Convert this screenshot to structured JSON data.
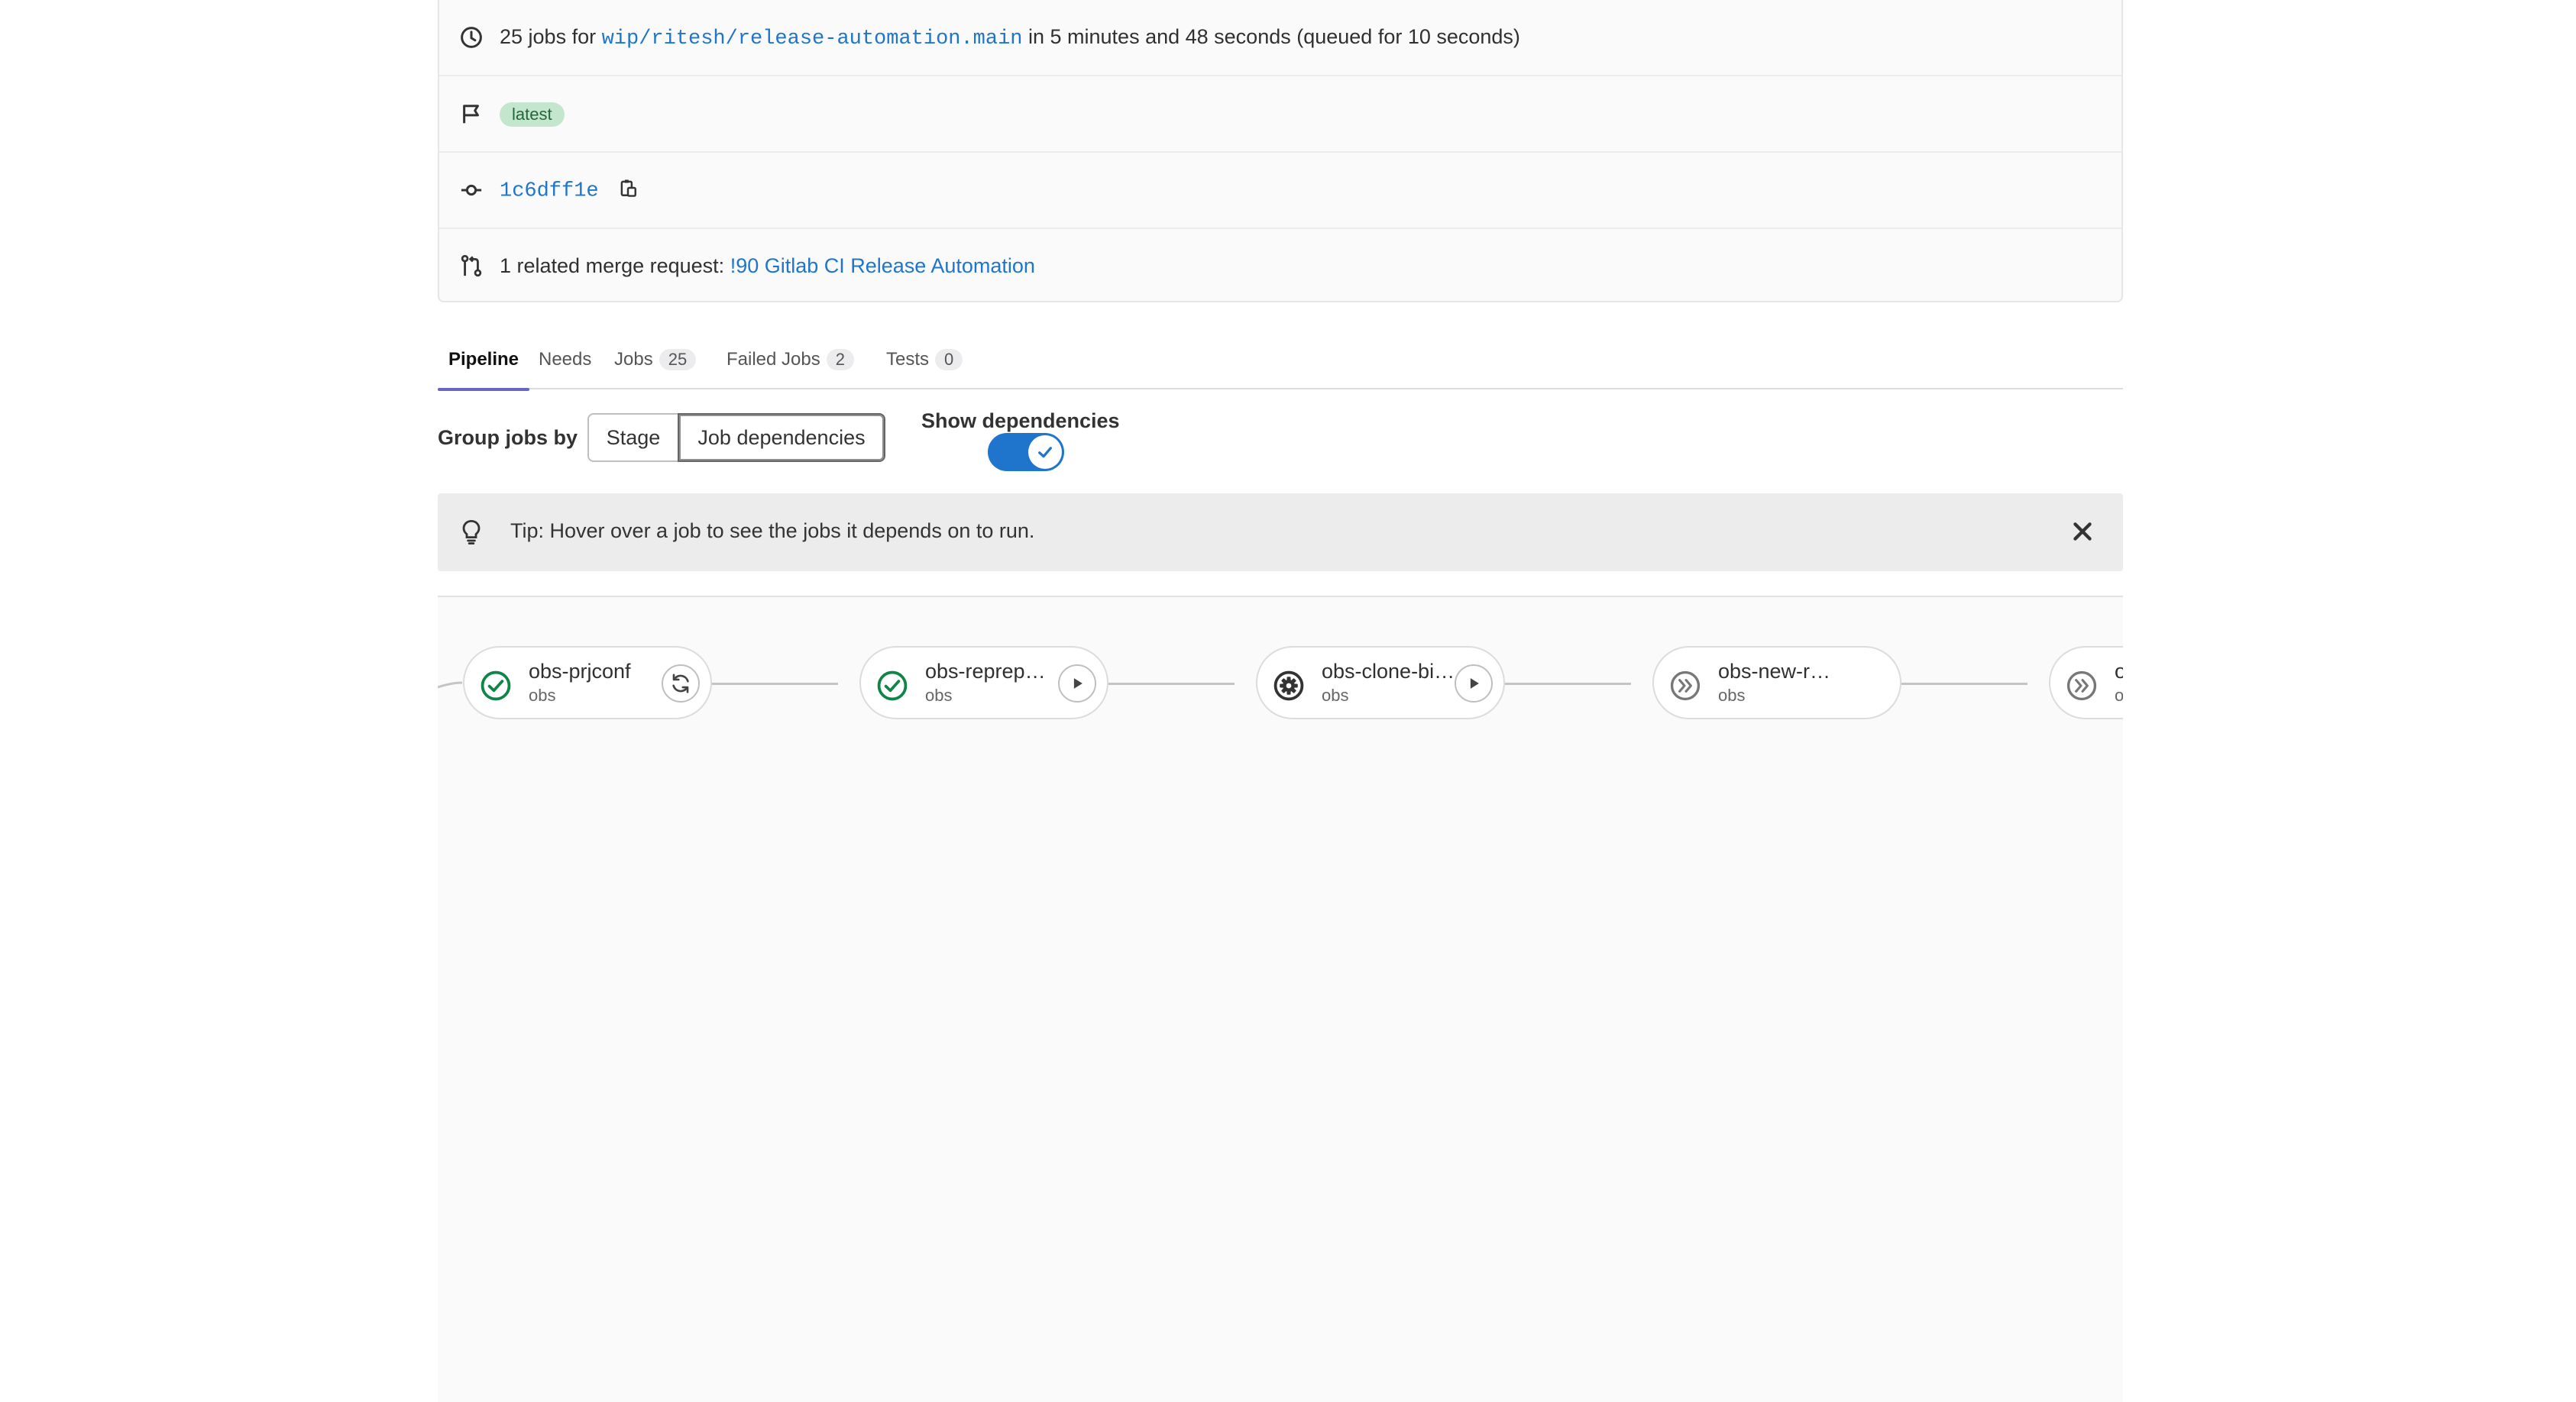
{
  "pipeline_info": {
    "jobs_summary_prefix": "25 jobs for",
    "ref": "wip/ritesh/release-automation.main",
    "jobs_summary_suffix": "in 5 minutes and 48 seconds (queued for 10 seconds)",
    "badge": "latest",
    "commit_sha": "1c6dff1e",
    "merge_request_prefix": "1 related merge request:",
    "merge_request_link": "!90 Gitlab CI Release Automation"
  },
  "tabs": [
    {
      "label": "Pipeline",
      "count": null
    },
    {
      "label": "Needs",
      "count": null
    },
    {
      "label": "Jobs",
      "count": "25"
    },
    {
      "label": "Failed Jobs",
      "count": "2"
    },
    {
      "label": "Tests",
      "count": "0"
    }
  ],
  "group_by": {
    "label": "Group jobs by",
    "options": [
      "Stage",
      "Job dependencies"
    ],
    "selected": "Job dependencies"
  },
  "show_dependencies": {
    "label": "Show dependencies",
    "enabled": true
  },
  "tip": {
    "text": "Tip: Hover over a job to see the jobs it depends on to run."
  },
  "jobs": [
    {
      "name": "obs-prjconf",
      "stage": "obs",
      "status": "success",
      "action": "retry"
    },
    {
      "name": "obs-reprep…",
      "stage": "obs",
      "status": "success",
      "action": "play"
    },
    {
      "name": "obs-clone-bi…",
      "stage": "obs",
      "status": "manual",
      "action": "play"
    },
    {
      "name": "obs-new-r…",
      "stage": "obs",
      "status": "skipped",
      "action": null
    },
    {
      "name": "o",
      "stage": "o",
      "status": "skipped",
      "action": null
    }
  ],
  "colors": {
    "link": "#1f75cb",
    "toggle_on": "#1f75cb",
    "status_success": "#108548",
    "tab_underline": "#6666c4",
    "badge_bg": "#c3e6cd"
  }
}
